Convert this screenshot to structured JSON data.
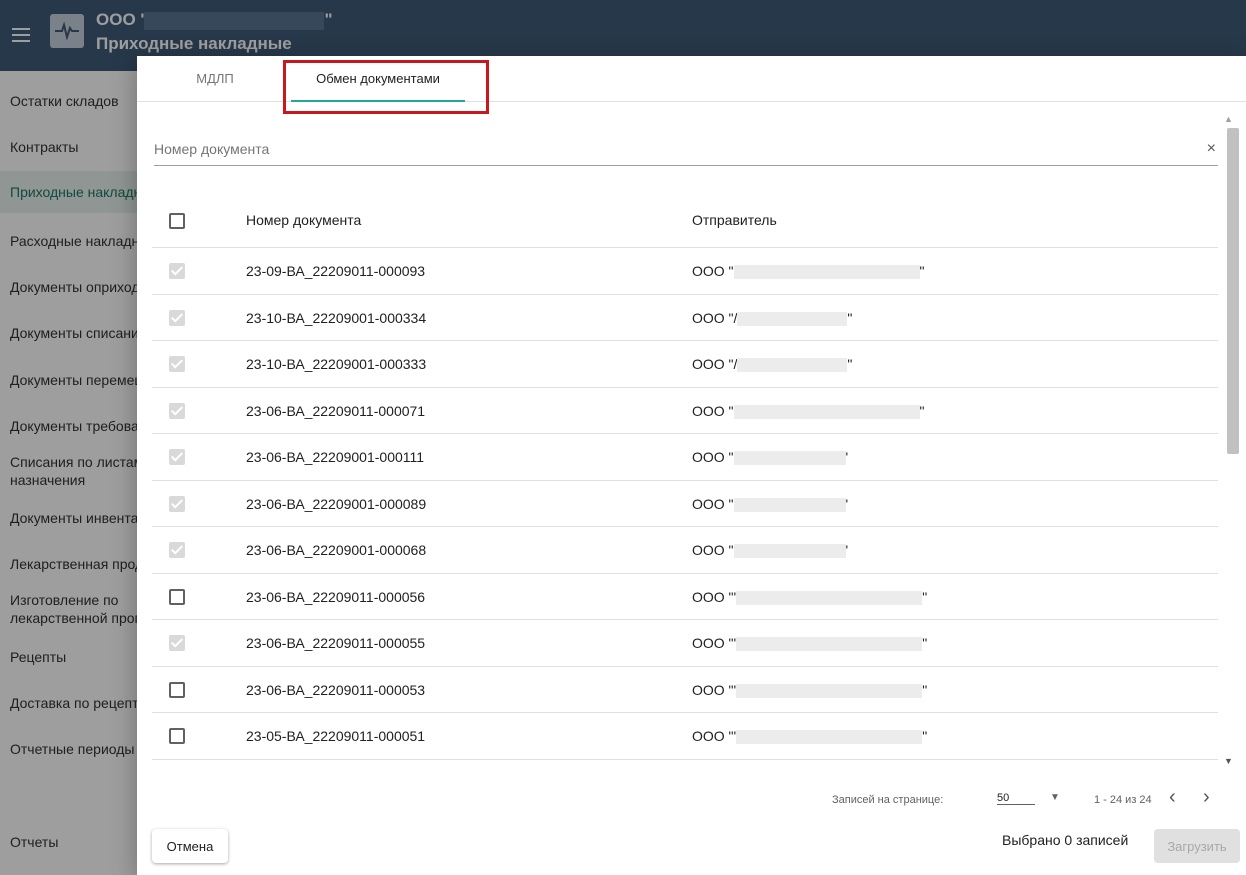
{
  "header": {
    "org_prefix": "ООО '",
    "org_suffix": "\"",
    "page_title": "Приходные накладные"
  },
  "sidebar": {
    "items": [
      {
        "label": "Остатки складов"
      },
      {
        "label": "Контракты"
      },
      {
        "label": "Приходные накладные"
      },
      {
        "label": "Расходные накладные"
      },
      {
        "label": "Документы оприходования"
      },
      {
        "label": "Документы списания"
      },
      {
        "label": "Документы перемещения"
      },
      {
        "label": "Документы требования"
      },
      {
        "label": "Списания по листам"
      },
      {
        "label": "назначения"
      },
      {
        "label": "Документы инвентаризации"
      },
      {
        "label": "Лекарственная продукция"
      },
      {
        "label": "Изготовление по"
      },
      {
        "label": "лекарственной прописи"
      },
      {
        "label": "Рецепты"
      },
      {
        "label": "Доставка по рецептам"
      },
      {
        "label": "Отчетные периоды"
      },
      {
        "label": "Отчеты"
      }
    ]
  },
  "dialog": {
    "tabs": [
      {
        "label": "МДЛП",
        "active": false
      },
      {
        "label": "Обмен документами",
        "active": true
      }
    ],
    "search": {
      "placeholder": "Номер документа",
      "value": "",
      "clear_icon": "×"
    },
    "columns": {
      "number": "Номер документа",
      "sender": "Отправитель"
    },
    "rows": [
      {
        "number": "23-09-ВА_22209011-000093",
        "sender": "ООО \"",
        "sender_end": "\"",
        "checked": true
      },
      {
        "number": "23-10-ВА_22209001-000334",
        "sender": "ООО \"/",
        "sender_end": "\"",
        "checked": true
      },
      {
        "number": "23-10-ВА_22209001-000333",
        "sender": "ООО \"/",
        "sender_end": "\"",
        "checked": true
      },
      {
        "number": "23-06-ВА_22209011-000071",
        "sender": "ООО \"",
        "sender_end": "\"",
        "checked": true
      },
      {
        "number": "23-06-ВА_22209001-000111",
        "sender": "ООО \"",
        "sender_end": "'",
        "checked": true
      },
      {
        "number": "23-06-ВА_22209001-000089",
        "sender": "ООО \"",
        "sender_end": "'",
        "checked": true
      },
      {
        "number": "23-06-ВА_22209001-000068",
        "sender": "ООО \"",
        "sender_end": "'",
        "checked": true
      },
      {
        "number": "23-06-ВА_22209011-000056",
        "sender": "ООО \"'",
        "sender_end": "\"",
        "checked": false
      },
      {
        "number": "23-06-ВА_22209011-000055",
        "sender": "ООО \"'",
        "sender_end": "\"",
        "checked": true
      },
      {
        "number": "23-06-ВА_22209011-000053",
        "sender": "ООО \"'",
        "sender_end": "\"",
        "checked": false
      },
      {
        "number": "23-05-ВА_22209011-000051",
        "sender": "ООО \"'",
        "sender_end": "\"",
        "checked": false
      }
    ],
    "footer": {
      "rows_per_page_label": "Записей на странице:",
      "rows_per_page_value": "50",
      "range": "1 - 24 из 24",
      "selected_text": "Выбрано 0 записей",
      "cancel_label": "Отмена",
      "load_label": "Загрузить"
    }
  }
}
